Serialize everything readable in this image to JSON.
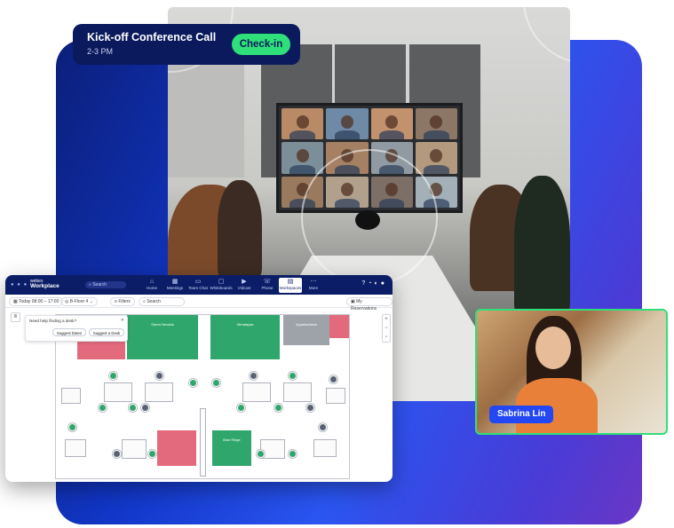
{
  "call_banner": {
    "title": "Kick-off Conference Call",
    "time": "2-3 PM",
    "checkin_label": "Check-in"
  },
  "participant": {
    "name": "Sabrina Lin"
  },
  "app": {
    "brand_small": "webex",
    "brand_name": "Workplace",
    "search_placeholder": "Search",
    "nav": [
      "Home",
      "Meetings",
      "Team Chat",
      "Whiteboards",
      "Vidcast",
      "Phone",
      "Workspaces",
      "More"
    ],
    "active_nav": "Workspaces",
    "toolbar": {
      "date": "Today",
      "time": "08:00 – 17:00",
      "floor": "B-Floor 4",
      "filters": "Filters",
      "search": "Search",
      "my_reservations": "My Reservations"
    },
    "notice": {
      "question": "Need help finding a desk?",
      "btn_colleague": "Suggest Dates",
      "btn_desk": "Suggest a Desk"
    },
    "rooms": {
      "room_a": "Sierra Nevada",
      "room_b": "Himalayas",
      "room_c": "Appalachians",
      "room_d": "Blue Ridge"
    },
    "colors": {
      "available": "#2fa66b",
      "occupied": "#e36a7d",
      "unavailable": "#9ea2a9",
      "accent": "#2fe07a"
    }
  }
}
